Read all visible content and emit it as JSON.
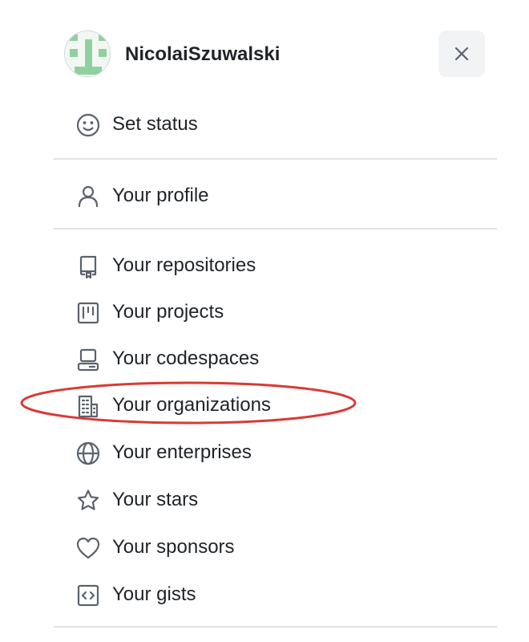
{
  "user": {
    "name": "NicolaiSzuwalski"
  },
  "menu": {
    "status": {
      "label": "Set status",
      "icon": "smiley-icon"
    },
    "profile": {
      "label": "Your profile",
      "icon": "person-icon"
    },
    "items": [
      {
        "label": "Your repositories",
        "icon": "repo-icon"
      },
      {
        "label": "Your projects",
        "icon": "project-icon"
      },
      {
        "label": "Your codespaces",
        "icon": "codespaces-icon"
      },
      {
        "label": "Your organizations",
        "icon": "organization-icon"
      },
      {
        "label": "Your enterprises",
        "icon": "globe-icon"
      },
      {
        "label": "Your stars",
        "icon": "star-icon"
      },
      {
        "label": "Your sponsors",
        "icon": "heart-icon"
      },
      {
        "label": "Your gists",
        "icon": "code-square-icon"
      }
    ]
  },
  "colors": {
    "text": "#1f2328",
    "icon": "#59636e",
    "divider": "#dfe3e8",
    "annotation": "#d93a34",
    "avatar_green": "#8fd19e"
  }
}
